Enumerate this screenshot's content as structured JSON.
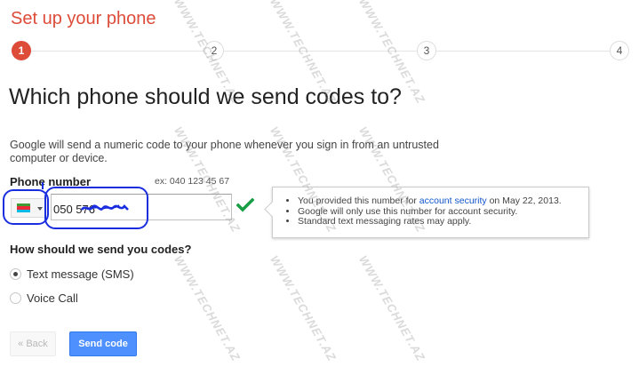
{
  "page": {
    "title": "Set up your phone",
    "heading": "Which phone should we send codes to?",
    "description": "Google will send a numeric code to your phone whenever you sign in from an untrusted computer or device."
  },
  "stepper": {
    "steps": [
      "1",
      "2",
      "3",
      "4"
    ],
    "active_step": 1
  },
  "phone": {
    "label": "Phone number",
    "example": "ex: 040 123 45 67",
    "country_flag": "azerbaijan-flag-icon",
    "value": "050 576",
    "valid": true
  },
  "info": {
    "item1_prefix": "You provided this number for ",
    "item1_link": "account security",
    "item1_suffix": " on May 22, 2013.",
    "item2": "Google will only use this number for account security.",
    "item3": "Standard text messaging rates may apply."
  },
  "delivery": {
    "label": "How should we send you codes?",
    "options": [
      "Text message (SMS)",
      "Voice Call"
    ],
    "selected": "Text message (SMS)"
  },
  "buttons": {
    "back": "« Back",
    "send": "Send code"
  },
  "watermark": "WWW.TECHNET.AZ",
  "colors": {
    "title": "#dd4b39",
    "active_step": "#dd4b39",
    "primary_button": "#4d90fe",
    "checkmark": "#199d45",
    "link": "#1155cc",
    "annotation": "#1a2ee0"
  }
}
